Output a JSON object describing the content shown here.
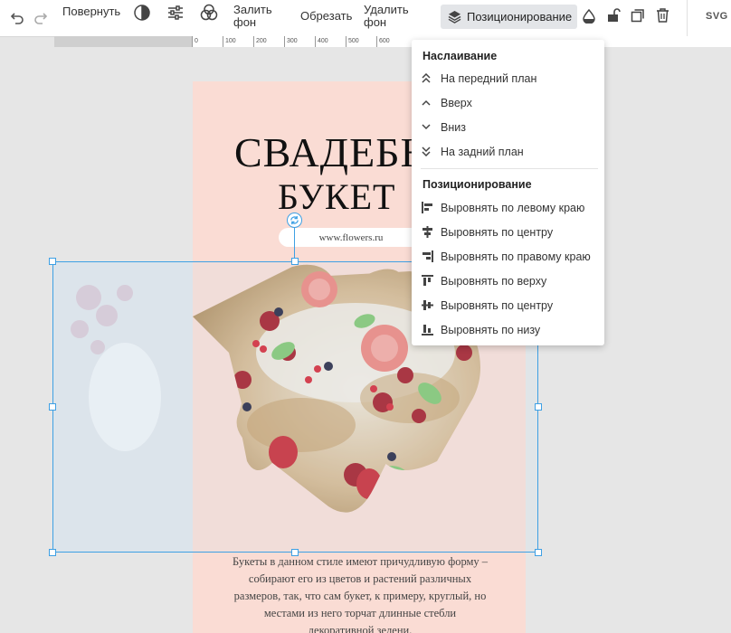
{
  "toolbar": {
    "rotate_label": "Повернуть",
    "fill_bg_label_1": "Залить",
    "fill_bg_label_2": "фон",
    "crop_label": "Обрезать",
    "remove_bg_label_1": "Удалить",
    "remove_bg_label_2": "фон",
    "positioning_label": "Позиционирование",
    "svg_label": "SVG"
  },
  "ruler": {
    "ticks": [
      "0",
      "100",
      "200",
      "300",
      "400",
      "500",
      "600"
    ]
  },
  "design": {
    "title_line1": "СВАДЕБН",
    "title_line2": "БУКЕТ",
    "url": "www.flowers.ru",
    "body_lines": [
      "Букеты в данном стиле имеют причудливую форму –",
      "собирают его из цветов и растений различных",
      "размеров, так, что сам букет, к примеру, круглый, но",
      "местами из него торчат длинные стебли",
      "декоративной зелени."
    ]
  },
  "menu": {
    "layering_header": "Наслаивание",
    "layering_items": [
      "На передний план",
      "Вверх",
      "Вниз",
      "На задний план"
    ],
    "positioning_header": "Позиционирование",
    "positioning_items": [
      "Выровнять по левому краю",
      "Выровнять по центру",
      "Выровнять по правому краю",
      "Выровнять по верху",
      "Выровнять по центру",
      "Выровнять по низу"
    ]
  },
  "colors": {
    "selection": "#3ea0e4",
    "page_bg": "#fadcd4",
    "menu_bg": "#ffffff"
  }
}
